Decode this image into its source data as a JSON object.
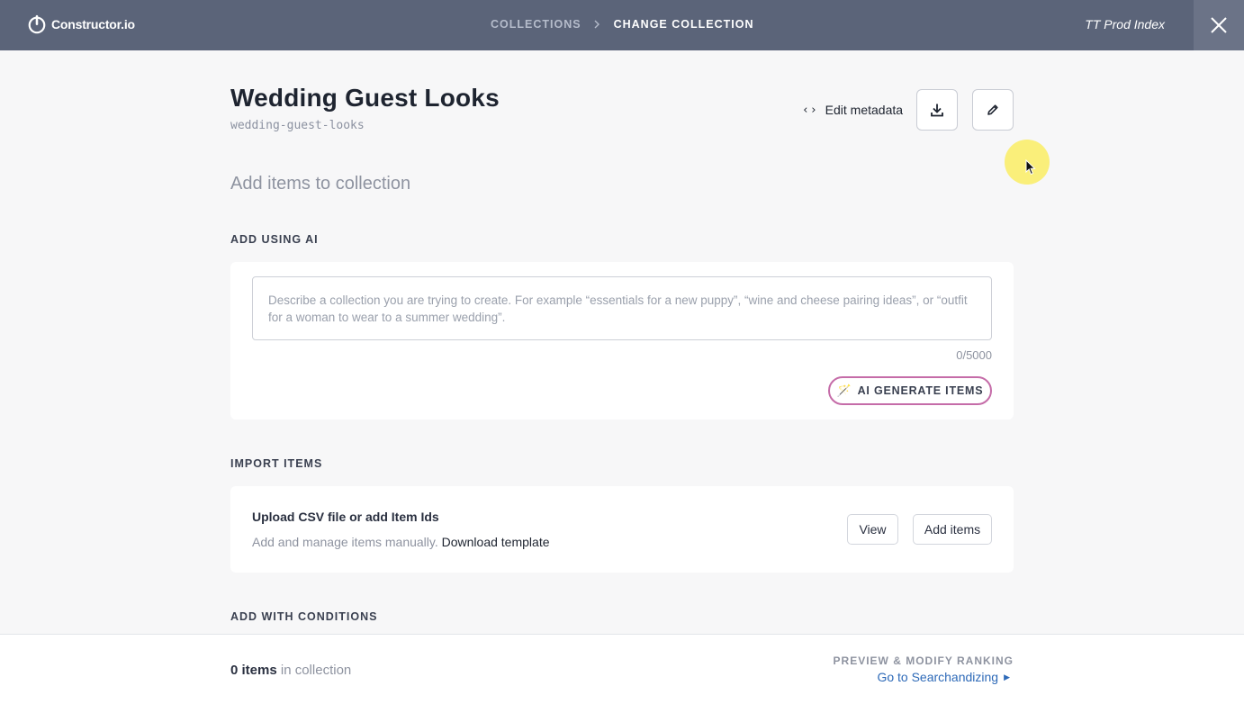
{
  "app": {
    "brand": "Constructor.io",
    "index_name": "TT Prod Index"
  },
  "breadcrumb": {
    "parent": "COLLECTIONS",
    "current": "CHANGE COLLECTION"
  },
  "collection": {
    "title": "Wedding Guest Looks",
    "slug": "wedding-guest-looks"
  },
  "header_actions": {
    "edit_metadata_label": "Edit metadata",
    "edit_metadata_glyph": "‹›"
  },
  "add_items": {
    "heading": "Add items to collection"
  },
  "ai_section": {
    "heading": "ADD USING AI",
    "placeholder": "Describe a collection you are trying to create. For example “essentials for a new puppy”, “wine and cheese pairing ideas”, or “outfit for a woman to wear to a summer wedding”.",
    "char_count": "0/5000",
    "button_label": "AI GENERATE ITEMS",
    "button_icon": "magic-wand-icon"
  },
  "import_section": {
    "heading": "IMPORT ITEMS",
    "title": "Upload CSV file or add Item Ids",
    "description": "Add and manage items manually.",
    "download_link": "Download template",
    "view_label": "View",
    "add_label": "Add items"
  },
  "conditions_section": {
    "heading": "ADD WITH CONDITIONS"
  },
  "footer": {
    "count": "0",
    "count_word": "items",
    "count_suffix": "in collection",
    "preview_label": "PREVIEW & MODIFY RANKING",
    "link_label": "Go to Searchandizing"
  },
  "colors": {
    "topbar": "#5b6479",
    "link": "#2e6ab8",
    "ai_accent": "#c56ca8"
  }
}
